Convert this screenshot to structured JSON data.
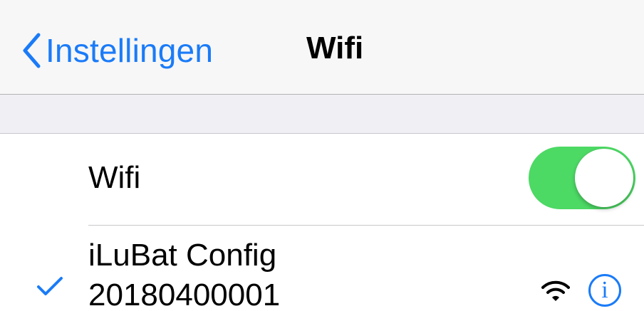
{
  "navbar": {
    "back_label": "Instellingen",
    "title": "Wifi"
  },
  "wifi_row": {
    "label": "Wifi",
    "toggle_on": true
  },
  "network": {
    "name_line1": "iLuBat Config",
    "name_line2": "20180400001",
    "selected": true,
    "info_label": "i"
  },
  "icons": {
    "back": "chevron-left-icon",
    "check": "checkmark-icon",
    "signal": "wifi-signal-icon",
    "info": "info-icon"
  },
  "colors": {
    "accent": "#1a7bf8",
    "toggle_on": "#4cd964",
    "navbar_bg": "#f7f7f7",
    "grouped_bg": "#efeff4"
  }
}
